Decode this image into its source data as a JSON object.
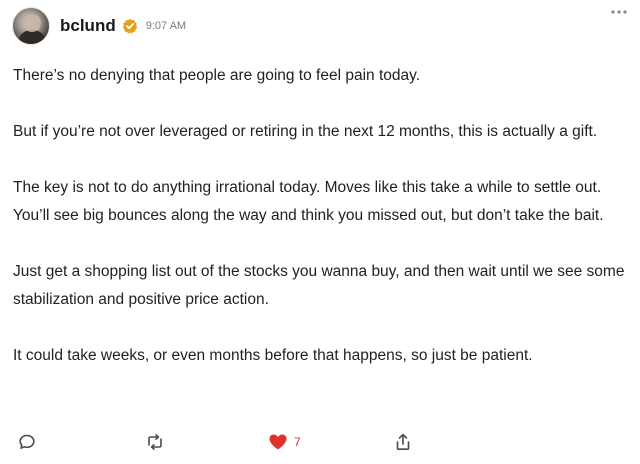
{
  "post": {
    "author": {
      "username": "bclund",
      "verified": true,
      "avatar": "profile-photo"
    },
    "timestamp": "9:07 AM",
    "more_menu_icon": "more-horizontal-icon",
    "paragraphs": [
      "There’s no denying that people are going to feel pain today.",
      "But if you’re not over leveraged or retiring in the next 12 months, this is actually a gift.",
      "The key is not to do anything irrational today. Moves like this take a while to settle out. You’ll see big bounces along the way and think you missed out, but don’t take the bait.",
      "Just get a shopping list out of the stocks you wanna buy, and then wait until we see some stabilization and positive price action.",
      "It could take weeks, or even months before that happens, so just be patient."
    ],
    "actions": {
      "comment_icon": "comment-icon",
      "restack_icon": "restack-icon",
      "like_icon": "heart-icon",
      "like_count": "7",
      "share_icon": "share-icon"
    },
    "colors": {
      "verified_badge": "#e6a11a",
      "like_heart": "#e0312b"
    }
  }
}
